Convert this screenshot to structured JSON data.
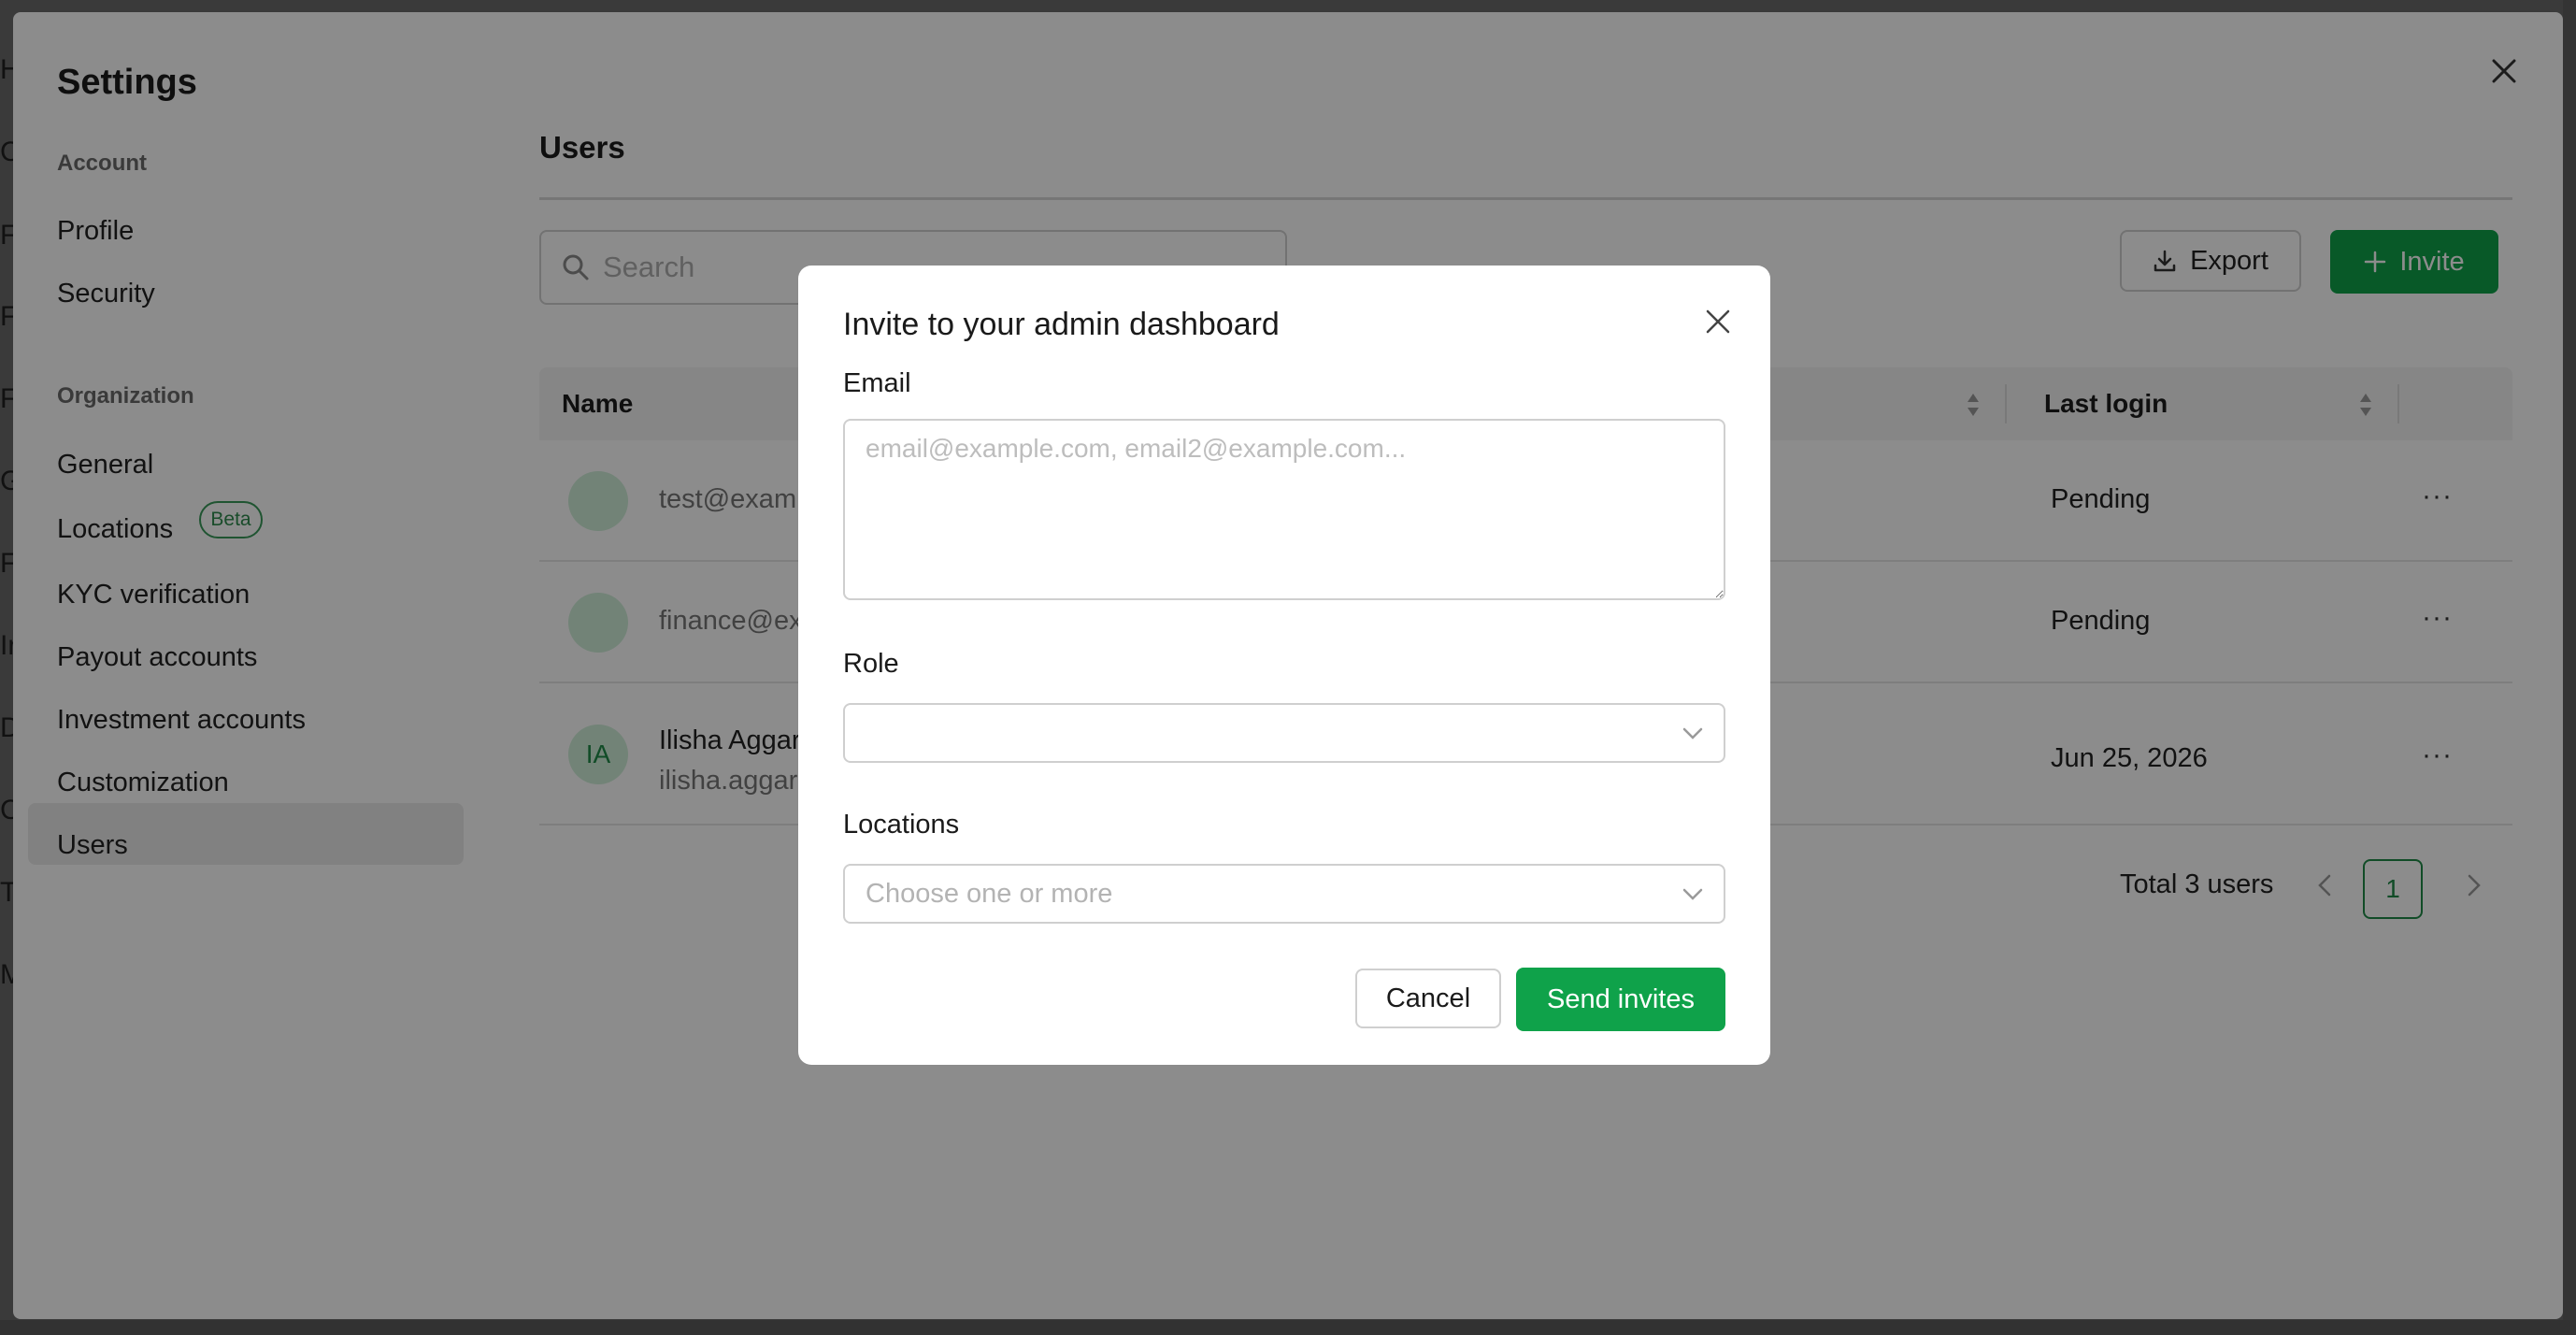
{
  "background": {
    "edge_letters": [
      "H",
      "C",
      "F",
      "F",
      "F",
      "G",
      "F",
      "Ir",
      "D",
      "C",
      "T",
      "M"
    ]
  },
  "settings": {
    "title": "Settings",
    "sidebar": {
      "sections": [
        {
          "label": "Account",
          "items": [
            {
              "label": "Profile"
            },
            {
              "label": "Security"
            }
          ]
        },
        {
          "label": "Organization",
          "items": [
            {
              "label": "General"
            },
            {
              "label": "Locations",
              "badge": "Beta"
            },
            {
              "label": "KYC verification"
            },
            {
              "label": "Payout accounts"
            },
            {
              "label": "Investment accounts"
            },
            {
              "label": "Customization"
            },
            {
              "label": "Users",
              "active": true
            }
          ]
        }
      ]
    }
  },
  "users_page": {
    "title": "Users",
    "search": {
      "placeholder": "Search"
    },
    "export_label": "Export",
    "invite_label": "Invite",
    "table": {
      "columns": [
        "Name",
        "Last login"
      ],
      "rows": [
        {
          "avatar": "",
          "name": "",
          "email": "test@examp",
          "last_login": "Pending"
        },
        {
          "avatar": "",
          "name": "",
          "email": "finance@ex",
          "last_login": "Pending"
        },
        {
          "avatar": "IA",
          "name": "Ilisha Aggar",
          "email": "ilisha.aggar",
          "last_login": "Jun 25, 2026"
        }
      ],
      "row_menu": "···"
    },
    "pagination": {
      "total": "Total 3 users",
      "current_page": "1"
    }
  },
  "modal": {
    "title": "Invite to your admin dashboard",
    "email_label": "Email",
    "email_placeholder": "email@example.com, email2@example.com...",
    "role_label": "Role",
    "role_value": "",
    "locations_label": "Locations",
    "locations_placeholder": "Choose one or more",
    "cancel_label": "Cancel",
    "send_label": "Send invites"
  },
  "colors": {
    "brand_green": "#0fa24a",
    "avatar_bg": "#cfeed9",
    "overlay": "rgba(0,0,0,0.45)"
  },
  "icons": [
    "close-icon",
    "search-icon",
    "download-icon",
    "plus-icon",
    "sort-icon",
    "chevron-down-icon",
    "chevron-left-icon",
    "chevron-right-icon",
    "more-icon"
  ]
}
